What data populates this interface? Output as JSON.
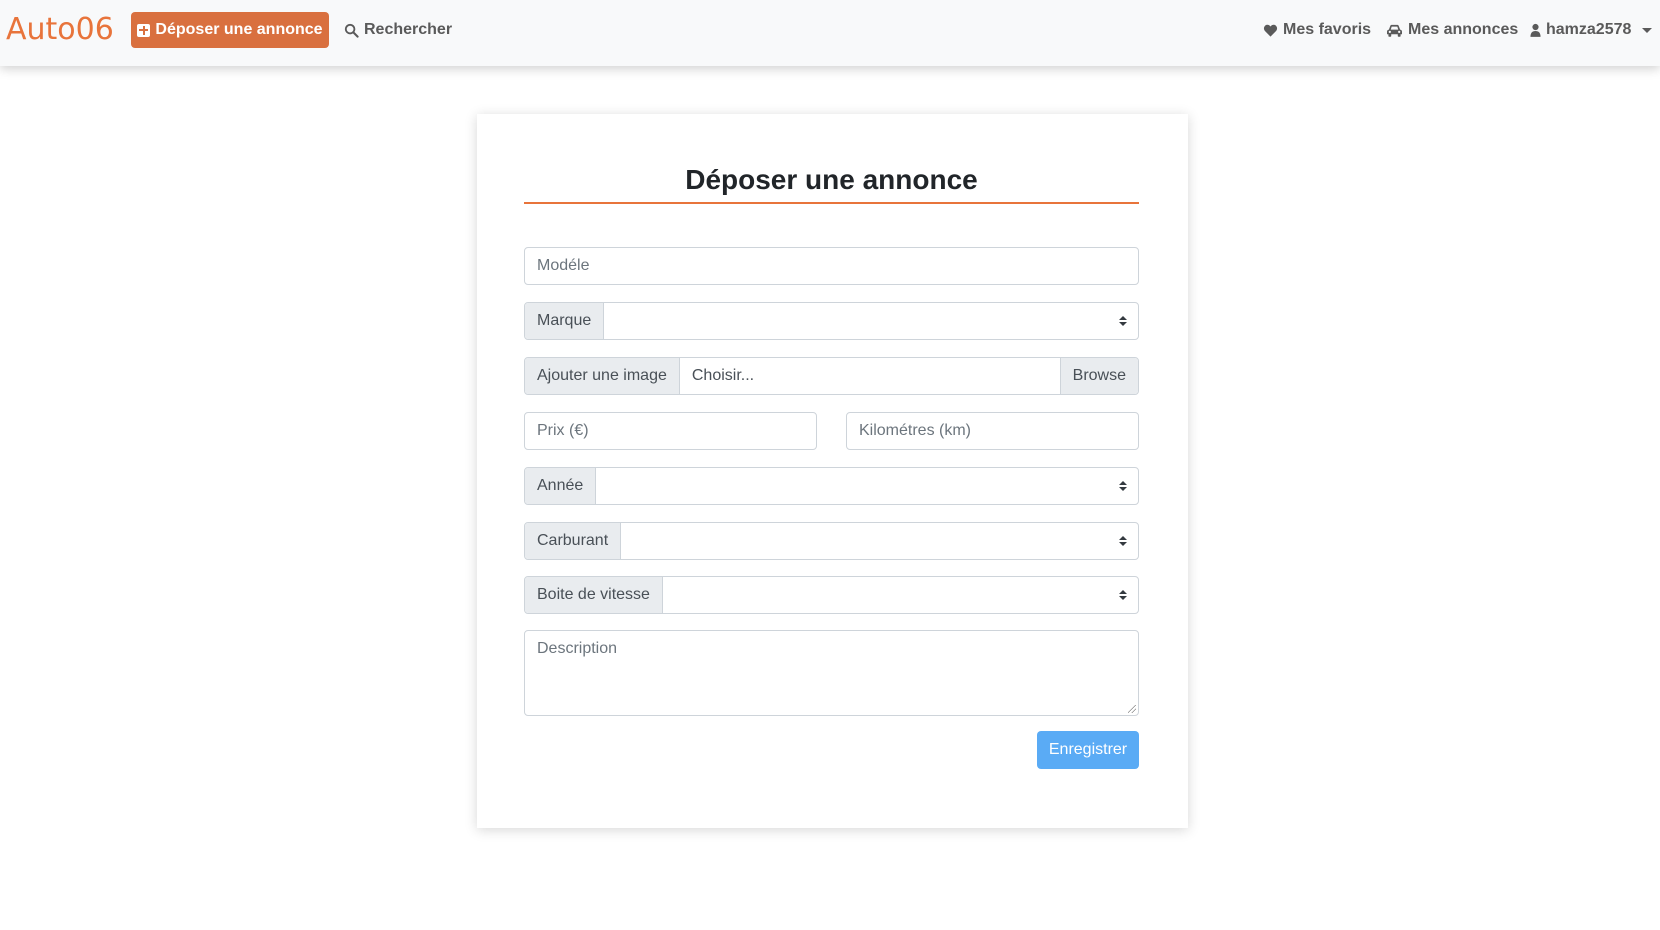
{
  "navbar": {
    "brand": "Auto06",
    "post_ad": "Déposer une annonce",
    "search": "Rechercher",
    "favorites": "Mes favoris",
    "my_ads": "Mes annonces",
    "user": "hamza2578"
  },
  "form": {
    "title": "Déposer une annonce",
    "model_placeholder": "Modéle",
    "brand_label": "Marque",
    "image_label": "Ajouter une image",
    "file_placeholder": "Choisir...",
    "browse_label": "Browse",
    "price_placeholder": "Prix (€)",
    "km_placeholder": "Kilométres (km)",
    "year_label": "Année",
    "fuel_label": "Carburant",
    "gearbox_label": "Boite de vitesse",
    "description_placeholder": "Description",
    "save_label": "Enregistrer"
  },
  "colors": {
    "accent": "#e8743b",
    "post_button": "#d9703f",
    "save_button": "#5aabf5"
  }
}
